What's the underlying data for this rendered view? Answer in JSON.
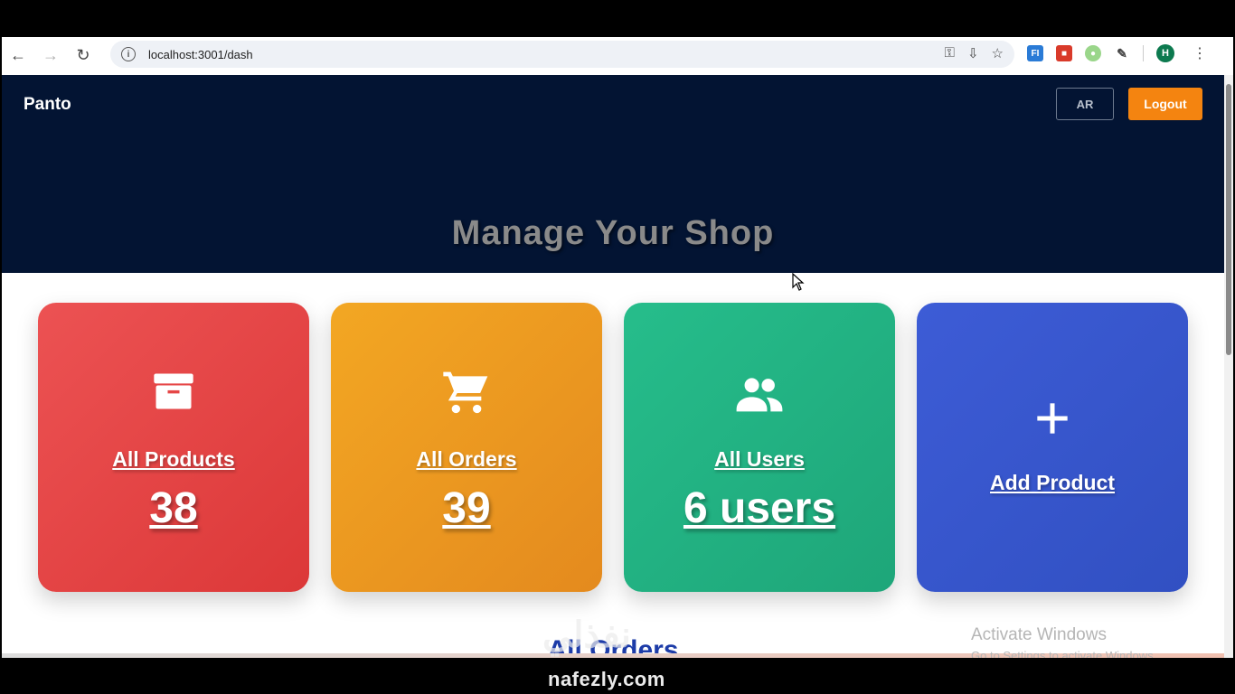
{
  "browser": {
    "url": "localhost:3001/dash",
    "avatar_letter": "H"
  },
  "navbar": {
    "brand": "Panto",
    "lang_button": "AR",
    "logout_button": "Logout"
  },
  "hero": {
    "title": "Manage Your Shop"
  },
  "cards": [
    {
      "label": "All Products",
      "value": "38",
      "icon": "archive-box-icon",
      "color": "#e54646"
    },
    {
      "label": "All Orders",
      "value": "39",
      "icon": "shopping-cart-icon",
      "color": "#ec9a20"
    },
    {
      "label": "All Users",
      "value": "6 users",
      "icon": "users-group-icon",
      "color": "#22b283"
    },
    {
      "label": "Add Product",
      "icon": "plus-icon",
      "color": "#3857cc"
    }
  ],
  "section": {
    "title": "All Orders"
  },
  "os_overlay": {
    "activate_title": "Activate Windows",
    "activate_sub": "Go to Settings to activate Windows."
  },
  "watermark": {
    "text": "nafezly.com",
    "text_ar": "نفذلي"
  },
  "colors": {
    "hero_bg": "#031433",
    "logout_bg": "#f48410",
    "section_title": "#1d3ca8"
  }
}
